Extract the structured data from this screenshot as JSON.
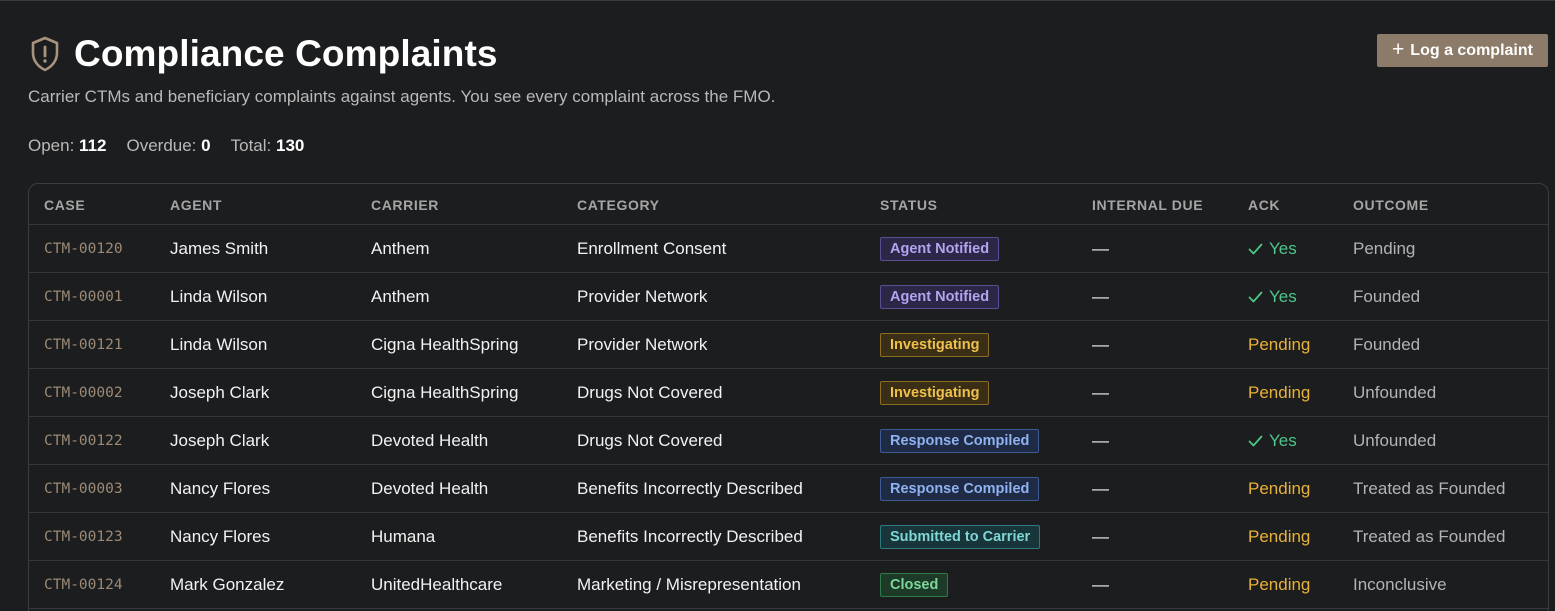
{
  "header": {
    "title": "Compliance Complaints",
    "subtitle": "Carrier CTMs and beneficiary complaints against agents. You see every complaint across the FMO.",
    "icon": "shield-alert-icon",
    "button_label": "Log a complaint"
  },
  "stats": {
    "open_label": "Open:",
    "open_value": "112",
    "overdue_label": "Overdue:",
    "overdue_value": "0",
    "total_label": "Total:",
    "total_value": "130"
  },
  "table": {
    "columns": [
      "CASE",
      "AGENT",
      "CARRIER",
      "CATEGORY",
      "STATUS",
      "INTERNAL DUE",
      "ACK",
      "OUTCOME"
    ],
    "rows": [
      {
        "case": "CTM-00120",
        "agent": "James Smith",
        "carrier": "Anthem",
        "category": "Enrollment Consent",
        "status": "Agent Notified",
        "due": "—",
        "ack": "Yes",
        "outcome": "Pending"
      },
      {
        "case": "CTM-00001",
        "agent": "Linda Wilson",
        "carrier": "Anthem",
        "category": "Provider Network",
        "status": "Agent Notified",
        "due": "—",
        "ack": "Yes",
        "outcome": "Founded"
      },
      {
        "case": "CTM-00121",
        "agent": "Linda Wilson",
        "carrier": "Cigna HealthSpring",
        "category": "Provider Network",
        "status": "Investigating",
        "due": "—",
        "ack": "Pending",
        "outcome": "Founded"
      },
      {
        "case": "CTM-00002",
        "agent": "Joseph Clark",
        "carrier": "Cigna HealthSpring",
        "category": "Drugs Not Covered",
        "status": "Investigating",
        "due": "—",
        "ack": "Pending",
        "outcome": "Unfounded"
      },
      {
        "case": "CTM-00122",
        "agent": "Joseph Clark",
        "carrier": "Devoted Health",
        "category": "Drugs Not Covered",
        "status": "Response Compiled",
        "due": "—",
        "ack": "Yes",
        "outcome": "Unfounded"
      },
      {
        "case": "CTM-00003",
        "agent": "Nancy Flores",
        "carrier": "Devoted Health",
        "category": "Benefits Incorrectly Described",
        "status": "Response Compiled",
        "due": "—",
        "ack": "Pending",
        "outcome": "Treated as Founded"
      },
      {
        "case": "CTM-00123",
        "agent": "Nancy Flores",
        "carrier": "Humana",
        "category": "Benefits Incorrectly Described",
        "status": "Submitted to Carrier",
        "due": "—",
        "ack": "Pending",
        "outcome": "Treated as Founded"
      },
      {
        "case": "CTM-00124",
        "agent": "Mark Gonzalez",
        "carrier": "UnitedHealthcare",
        "category": "Marketing / Misrepresentation",
        "status": "Closed",
        "due": "—",
        "ack": "Pending",
        "outcome": "Inconclusive"
      }
    ]
  },
  "colors": {
    "background": "#1c1d1f",
    "accent_button": "#8d7b69",
    "ack_yes": "#4fc68a",
    "ack_pending": "#e8b23a"
  }
}
